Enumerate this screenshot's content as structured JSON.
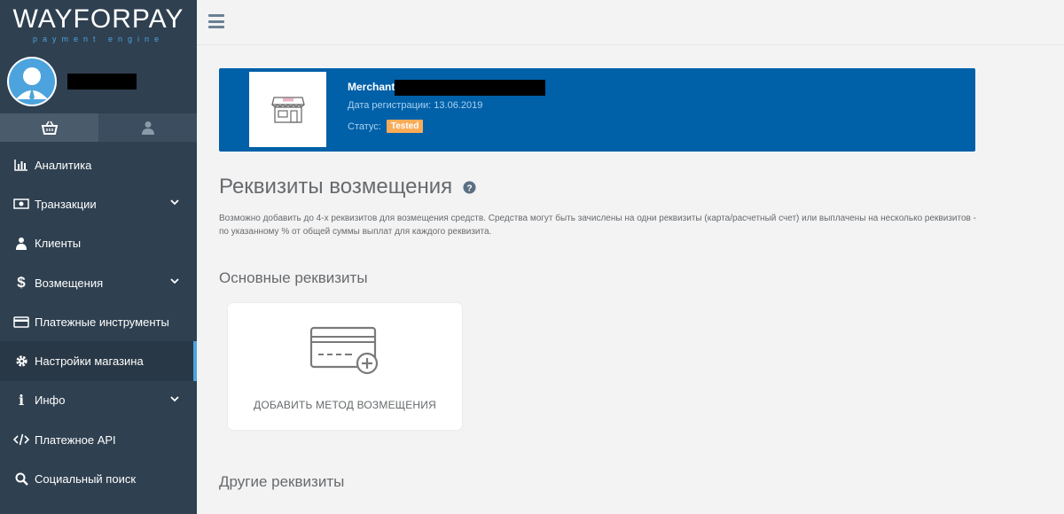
{
  "logo": {
    "text": "WAYFORPAY",
    "subtitle": "payment engine"
  },
  "profile": {
    "avatar_icon": "user-avatar-icon"
  },
  "sidebar_tabs": [
    {
      "icon": "basket-icon",
      "active": true
    },
    {
      "icon": "user-icon",
      "active": false
    }
  ],
  "nav": {
    "items": [
      {
        "label": "Аналитика",
        "icon": "bar-chart-icon",
        "has_chevron": false
      },
      {
        "label": "Транзакции",
        "icon": "money-icon",
        "has_chevron": true
      },
      {
        "label": "Клиенты",
        "icon": "users-icon",
        "has_chevron": false
      },
      {
        "label": "Возмещения",
        "icon": "dollar-icon",
        "has_chevron": true
      },
      {
        "label": "Платежные инструменты",
        "icon": "credit-card-icon",
        "has_chevron": false
      },
      {
        "label": "Настройки магазина",
        "icon": "gear-icon",
        "has_chevron": false,
        "active": true
      },
      {
        "label": "Инфо",
        "icon": "info-icon",
        "has_chevron": true
      },
      {
        "label": "Платежное API",
        "icon": "code-icon",
        "has_chevron": false
      },
      {
        "label": "Социальный поиск",
        "icon": "search-icon",
        "has_chevron": false
      }
    ]
  },
  "merchant": {
    "name_label": "Merchant",
    "date": "Дата регистрации: 13.06.2019",
    "status_label": "Статус:",
    "status_value": "Tested",
    "image_icon": "shop-icon"
  },
  "page": {
    "title": "Реквизиты возмещения",
    "description": "Возможно добавить до 4-х реквизитов для возмещения средств. Средства могут быть зачислены на одни реквизиты (карта/расчетный счет) или выплачены на несколько реквизитов - по указанному % от общей суммы выплат для каждого реквизита.",
    "main_section": "Основные реквизиты",
    "add_method": "ДОБАВИТЬ МЕТОД ВОЗМЕЩЕНИЯ",
    "other_section": "Другие реквизиты"
  },
  "colors": {
    "sidebar": "#2f4050",
    "merchant_card": "#0060a8",
    "badge": "#f8ac59",
    "active_indicator": "#4ca3dd"
  }
}
